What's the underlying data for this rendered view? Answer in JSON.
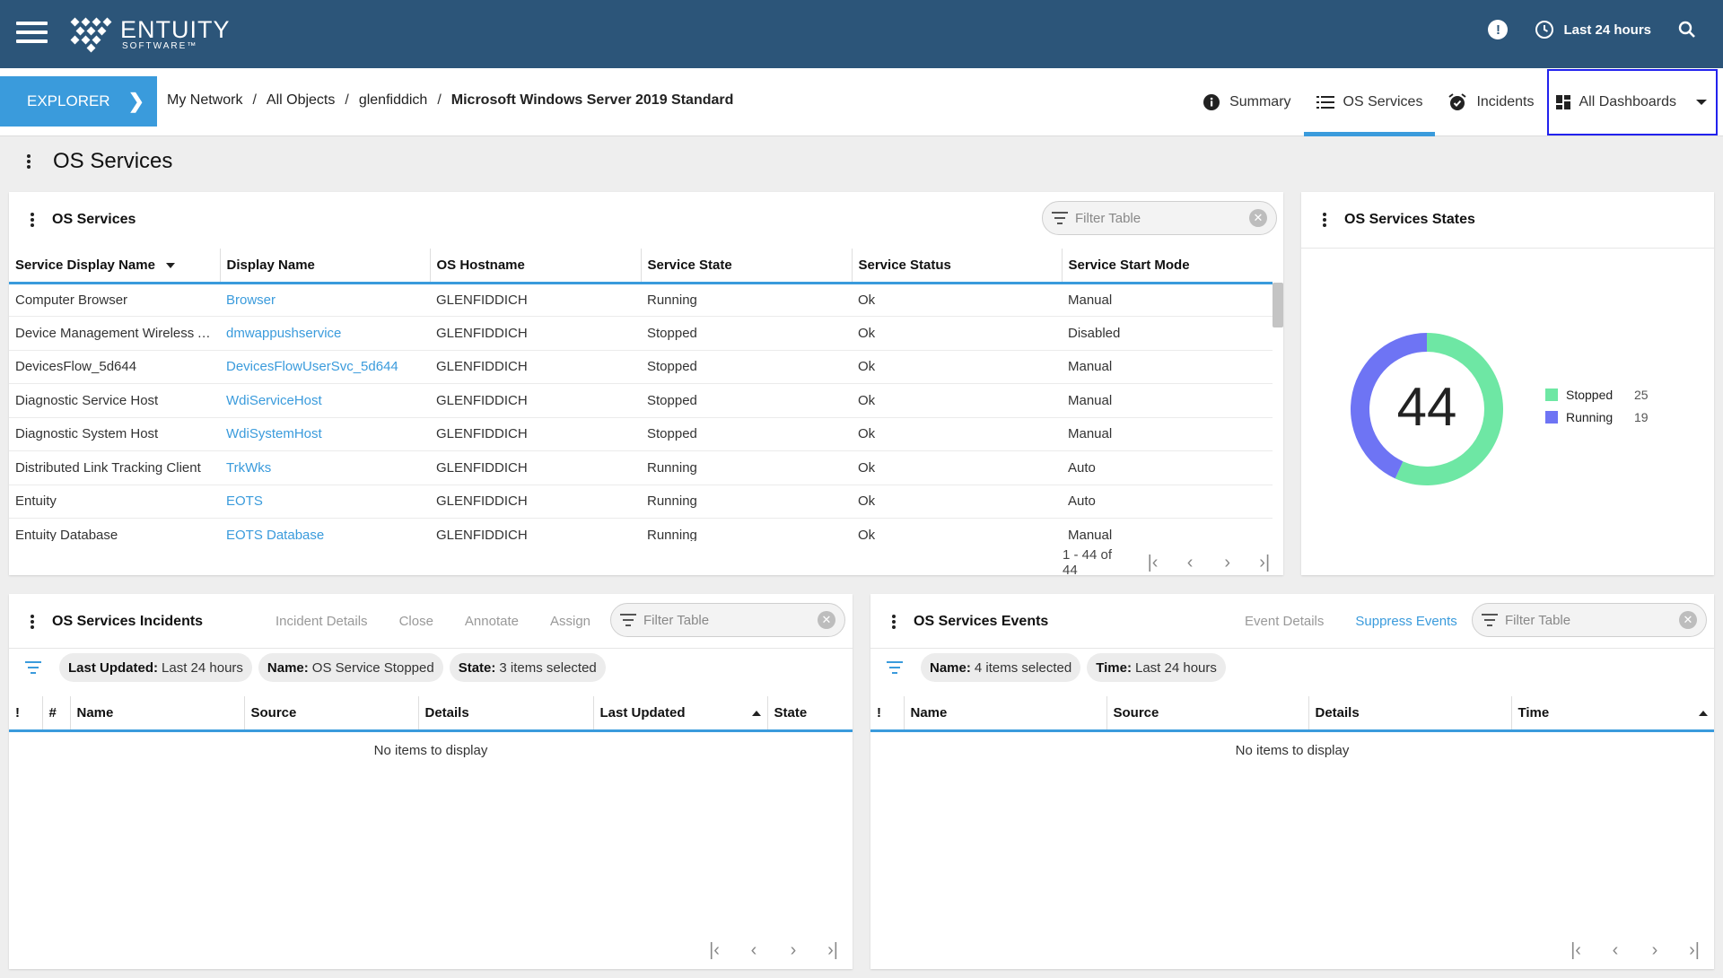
{
  "brand": {
    "name": "ENTUITY",
    "sub": "SOFTWARE™"
  },
  "header": {
    "time_range": "Last 24 hours",
    "notification_glyph": "!"
  },
  "nav": {
    "explorer_label": "EXPLORER",
    "breadcrumb": [
      "My Network",
      "All Objects",
      "glenfiddich",
      "Microsoft Windows Server 2019 Standard"
    ],
    "tabs": [
      {
        "label": "Summary",
        "icon": "info-icon"
      },
      {
        "label": "OS Services",
        "icon": "list-icon",
        "active": true
      },
      {
        "label": "Incidents",
        "icon": "alarm-icon"
      },
      {
        "label": "All Dashboards",
        "icon": "dashboard-icon"
      }
    ]
  },
  "page": {
    "title": "OS Services"
  },
  "services": {
    "title": "OS Services",
    "filter_placeholder": "Filter Table",
    "columns": [
      "Service Display Name",
      "Display Name",
      "OS Hostname",
      "Service State",
      "Service Status",
      "Service Start Mode"
    ],
    "rows": [
      [
        "Computer Browser",
        "Browser",
        "GLENFIDDICH",
        "Running",
        "Ok",
        "Manual"
      ],
      [
        "Device Management Wireless A...",
        "dmwappushservice",
        "GLENFIDDICH",
        "Stopped",
        "Ok",
        "Disabled"
      ],
      [
        "DevicesFlow_5d644",
        "DevicesFlowUserSvc_5d644",
        "GLENFIDDICH",
        "Stopped",
        "Ok",
        "Manual"
      ],
      [
        "Diagnostic Service Host",
        "WdiServiceHost",
        "GLENFIDDICH",
        "Stopped",
        "Ok",
        "Manual"
      ],
      [
        "Diagnostic System Host",
        "WdiSystemHost",
        "GLENFIDDICH",
        "Stopped",
        "Ok",
        "Manual"
      ],
      [
        "Distributed Link Tracking Client",
        "TrkWks",
        "GLENFIDDICH",
        "Running",
        "Ok",
        "Auto"
      ],
      [
        "Entuity",
        "EOTS",
        "GLENFIDDICH",
        "Running",
        "Ok",
        "Auto"
      ],
      [
        "Entuity Database",
        "EOTS Database",
        "GLENFIDDICH",
        "Running",
        "Ok",
        "Manual"
      ]
    ],
    "pager_text": "1 - 44 of 44"
  },
  "states": {
    "title": "OS Services States",
    "total": "44",
    "legend": [
      {
        "label": "Stopped",
        "count": "25",
        "color": "#6ee7a4"
      },
      {
        "label": "Running",
        "count": "19",
        "color": "#6e74f4"
      }
    ]
  },
  "chart_data": {
    "type": "pie",
    "categories": [
      "Stopped",
      "Running"
    ],
    "values": [
      25,
      19
    ],
    "center_label": "44"
  },
  "incidents": {
    "title": "OS Services Incidents",
    "actions": [
      "Incident Details",
      "Close",
      "Annotate",
      "Assign"
    ],
    "filter_placeholder": "Filter Table",
    "chips": [
      {
        "key": "Last Updated:",
        "value": "Last 24 hours"
      },
      {
        "key": "Name:",
        "value": "OS Service Stopped"
      },
      {
        "key": "State:",
        "value": "3 items selected"
      }
    ],
    "columns": [
      "!",
      "#",
      "Name",
      "Source",
      "Details",
      "Last Updated",
      "State"
    ],
    "empty": "No items to display"
  },
  "events": {
    "title": "OS Services Events",
    "actions": [
      "Event Details",
      "Suppress Events"
    ],
    "filter_placeholder": "Filter Table",
    "chips": [
      {
        "key": "Name:",
        "value": "4 items selected"
      },
      {
        "key": "Time:",
        "value": "Last 24 hours"
      }
    ],
    "columns": [
      "!",
      "Name",
      "Source",
      "Details",
      "Time"
    ],
    "empty": "No items to display"
  },
  "pager_glyphs": {
    "first": "|‹",
    "prev": "‹",
    "next": "›",
    "last": "›|"
  }
}
